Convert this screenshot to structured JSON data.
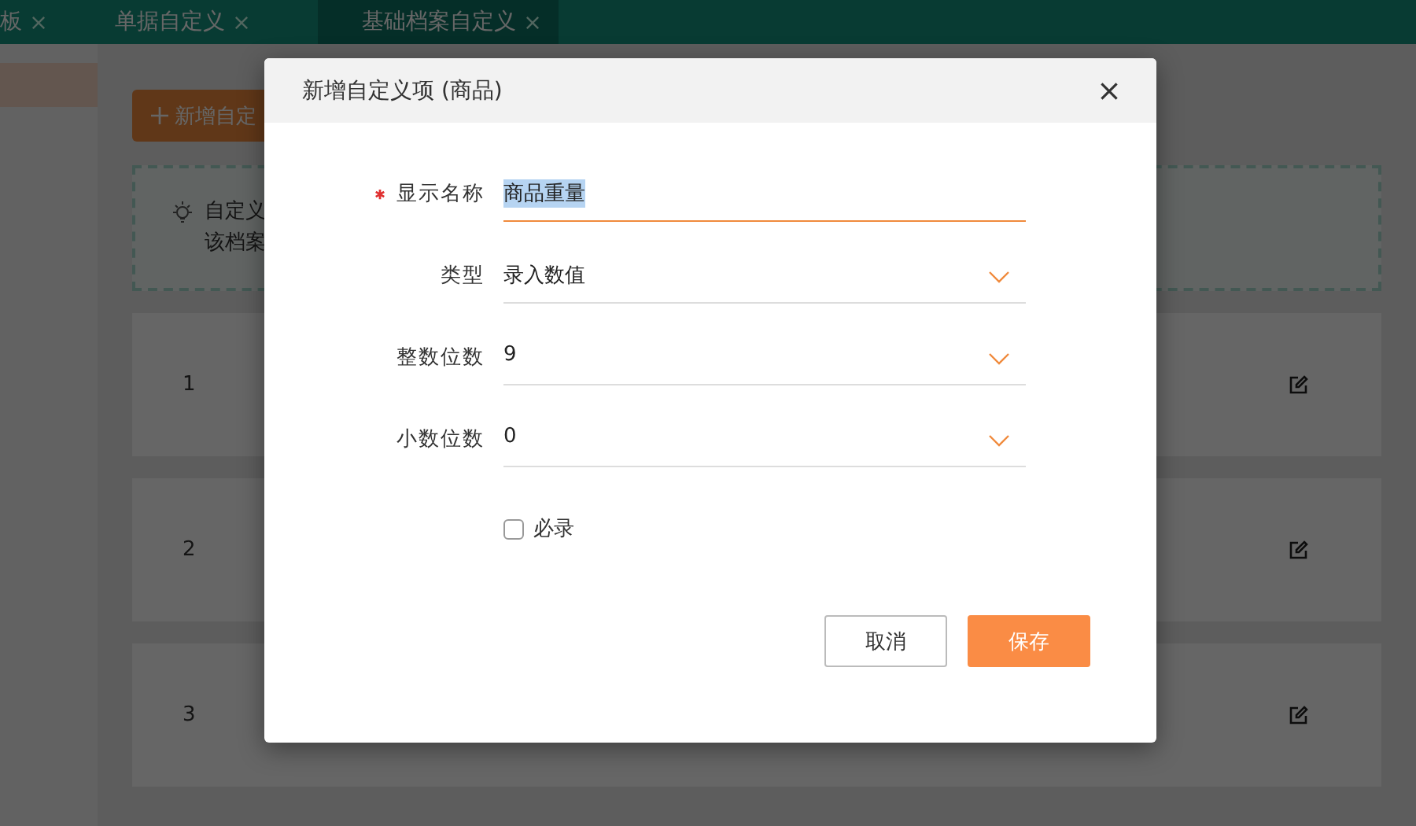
{
  "tabs": [
    {
      "label": "板",
      "selected": false
    },
    {
      "label": "单据自定义",
      "selected": false
    },
    {
      "label": "基础档案自定义",
      "selected": true
    }
  ],
  "add_button": "新增自定",
  "tip": {
    "lines": [
      "自定义",
      "该档案"
    ]
  },
  "rows": [
    {
      "index": "1"
    },
    {
      "index": "2"
    },
    {
      "index": "3"
    }
  ],
  "dialog": {
    "title": "新增自定义项 (商品)",
    "fields": [
      {
        "kind": "text",
        "label": "显示名称",
        "required": true,
        "value": "商品重量",
        "focused": true
      },
      {
        "kind": "select",
        "label": "类型",
        "required": false,
        "value": "录入数值",
        "focused": false
      },
      {
        "kind": "select",
        "label": "整数位数",
        "required": false,
        "value": "9",
        "focused": false
      },
      {
        "kind": "select",
        "label": "小数位数",
        "required": false,
        "value": "0",
        "focused": false
      }
    ],
    "checkbox": {
      "label": "必录",
      "checked": false
    },
    "buttons": [
      {
        "label": "取消",
        "kind": "secondary"
      },
      {
        "label": "保存",
        "kind": "primary"
      }
    ]
  }
}
